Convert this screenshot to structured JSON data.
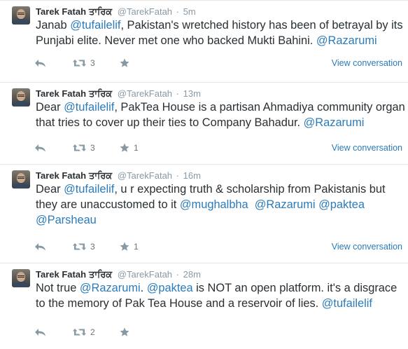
{
  "tweets": [
    {
      "fullname": "Tarek Fatah",
      "punjabi_name": "ਤਾਰਿਕ",
      "username": "@TarekFatah",
      "time": "5m",
      "segments": [
        {
          "text": "Janab ",
          "mention": false
        },
        {
          "text": "@tufailelif",
          "mention": true
        },
        {
          "text": ", Pakistan's wretched history has been of  betrayal by its Punjabi elite. Never met one who backed Mukti Bahini. ",
          "mention": false
        },
        {
          "text": "@Razarumi",
          "mention": true
        }
      ],
      "retweets": "3",
      "favorites": "",
      "view_conversation": "View conversation"
    },
    {
      "fullname": "Tarek Fatah",
      "punjabi_name": "ਤਾਰਿਕ",
      "username": "@TarekFatah",
      "time": "13m",
      "segments": [
        {
          "text": "Dear ",
          "mention": false
        },
        {
          "text": "@tufailelif",
          "mention": true
        },
        {
          "text": ", PakTea House is a partisan Ahmadiya community organ that tries to cover up their ties to Company Bahadur. ",
          "mention": false
        },
        {
          "text": "@Razarumi",
          "mention": true
        }
      ],
      "retweets": "3",
      "favorites": "1",
      "view_conversation": "View conversation"
    },
    {
      "fullname": "Tarek Fatah",
      "punjabi_name": "ਤਾਰਿਕ",
      "username": "@TarekFatah",
      "time": "16m",
      "segments": [
        {
          "text": "Dear ",
          "mention": false
        },
        {
          "text": "@tufailelif",
          "mention": true
        },
        {
          "text": ", u r expecting truth & scholarship from Pakistanis but they are unaccustomed to it ",
          "mention": false
        },
        {
          "text": "@mughalbha",
          "mention": true
        },
        {
          "text": "  ",
          "mention": false
        },
        {
          "text": "@Razarumi",
          "mention": true
        },
        {
          "text": " ",
          "mention": false
        },
        {
          "text": "@paktea",
          "mention": true
        },
        {
          "text": " ",
          "mention": false
        },
        {
          "text": "@Parsheau",
          "mention": true
        }
      ],
      "retweets": "3",
      "favorites": "1",
      "view_conversation": "View conversation"
    },
    {
      "fullname": "Tarek Fatah",
      "punjabi_name": "ਤਾਰਿਕ",
      "username": "@TarekFatah",
      "time": "28m",
      "segments": [
        {
          "text": "Not true ",
          "mention": false
        },
        {
          "text": "@Razarumi",
          "mention": true
        },
        {
          "text": ". ",
          "mention": false
        },
        {
          "text": "@paktea",
          "mention": true
        },
        {
          "text": " is NOT an open platform. it's a disgrace to the memory of Pak Tea House and a reservoir of lies. ",
          "mention": false
        },
        {
          "text": "@tufailelif",
          "mention": true
        }
      ],
      "retweets": "2",
      "favorites": "",
      "view_conversation": ""
    }
  ],
  "separator": "·",
  "colors": {
    "text": "#292f33",
    "mention": "#2b7bb9",
    "muted": "#8899a6",
    "border": "#e8e8e8"
  },
  "icons": {
    "reply": "reply-icon",
    "retweet": "retweet-icon",
    "favorite": "star-icon"
  }
}
